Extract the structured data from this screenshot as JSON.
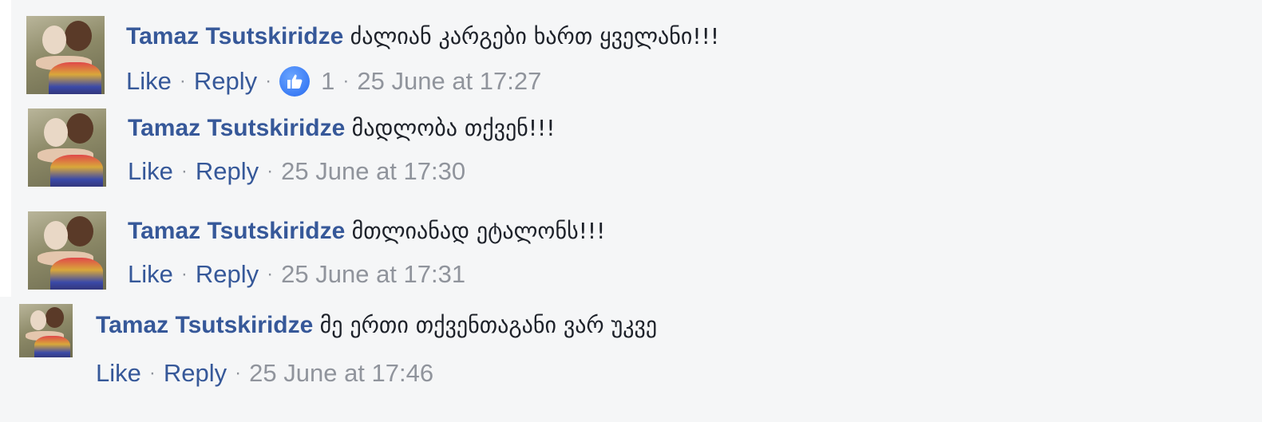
{
  "comments": [
    {
      "author": "Tamaz Tsutskiridze",
      "text": "ძალიან კარგები ხართ ყველანი!!!",
      "like_label": "Like",
      "reply_label": "Reply",
      "reaction_count": "1",
      "timestamp": "25 June at 17:27"
    },
    {
      "author": "Tamaz Tsutskiridze",
      "text": "მადლობა თქვენ!!!",
      "like_label": "Like",
      "reply_label": "Reply",
      "timestamp": "25 June at 17:30"
    },
    {
      "author": "Tamaz Tsutskiridze",
      "text": "მთლიანად ეტალონს!!!",
      "like_label": "Like",
      "reply_label": "Reply",
      "timestamp": "25 June at 17:31"
    },
    {
      "author": "Tamaz Tsutskiridze",
      "text": "მე ერთი თქვენთაგანი ვარ უკვე",
      "like_label": "Like",
      "reply_label": "Reply",
      "timestamp": "25 June at 17:46"
    }
  ],
  "separator": "·",
  "colors": {
    "author": "#365899",
    "meta": "#90949c",
    "text": "#1d2129",
    "background": "#f5f6f7",
    "like_badge": "#5890ff"
  },
  "icons": {
    "reaction": "thumbs-up-icon"
  }
}
